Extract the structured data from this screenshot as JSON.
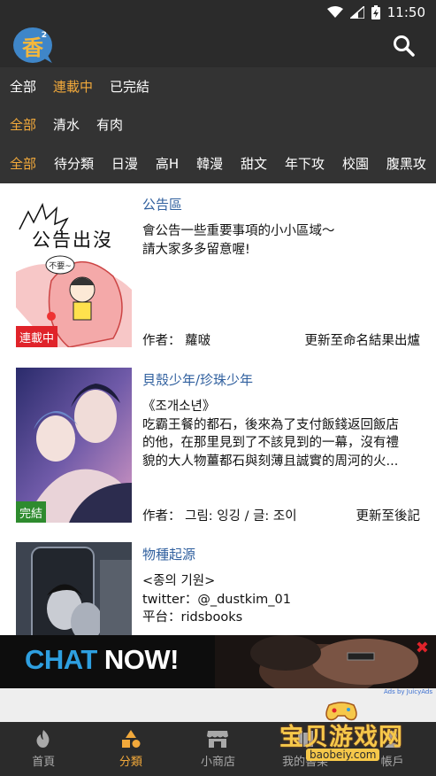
{
  "status_bar": {
    "time": "11:50"
  },
  "header": {
    "logo_text": "香",
    "logo_sup": "2"
  },
  "filters": {
    "status": [
      {
        "label": "全部",
        "active": false
      },
      {
        "label": "連載中",
        "active": true
      },
      {
        "label": "已完結",
        "active": false
      }
    ],
    "type": [
      {
        "label": "全部",
        "active": true
      },
      {
        "label": "清水",
        "active": false
      },
      {
        "label": "有肉",
        "active": false
      }
    ],
    "genre": [
      {
        "label": "全部",
        "active": true
      },
      {
        "label": "待分類",
        "active": false
      },
      {
        "label": "日漫",
        "active": false
      },
      {
        "label": "高H",
        "active": false
      },
      {
        "label": "韓漫",
        "active": false
      },
      {
        "label": "甜文",
        "active": false
      },
      {
        "label": "年下攻",
        "active": false
      },
      {
        "label": "校園",
        "active": false
      },
      {
        "label": "腹黑攻",
        "active": false
      }
    ]
  },
  "items": [
    {
      "title": "公告區",
      "desc": [
        "會公告一些重要事項的小小區域～",
        "請大家多多留意喔!"
      ],
      "thumb_text": "公告出沒",
      "bubble_text": "不要~",
      "badge": "連載中",
      "author": "作者：  蘿啵",
      "update": "更新至命名結果出爐"
    },
    {
      "title": "貝殼少年/珍珠少年",
      "desc": [
        "《조개소년》",
        "吃霸王餐的都石，後來為了支付飯錢返回飯店",
        "的他，在那里見到了不該見到的一幕，沒有禮",
        "貌的大人物薑都石與刻薄且誠實的周河的火..."
      ],
      "badge": "完結",
      "author": "作者：  그림: 잉깅 / 글: 조이",
      "update": "更新至後記"
    },
    {
      "title": "物種起源",
      "desc": [
        "<종의 기원>",
        "twitter：@_dustkim_01",
        "平台：ridsbooks",
        "..."
      ]
    }
  ],
  "ad": {
    "text_part1": "CHAT",
    "text_part2": "NOW!",
    "close": "✖",
    "credit": "Ads by JuicyAds"
  },
  "nav": [
    {
      "label": "首頁",
      "icon": "flame-icon",
      "active": false
    },
    {
      "label": "分類",
      "icon": "shapes-icon",
      "active": true
    },
    {
      "label": "小商店",
      "icon": "store-icon",
      "active": false
    },
    {
      "label": "我的書架",
      "icon": "bookshelf-icon",
      "active": false
    },
    {
      "label": "帳戶",
      "icon": "account-icon",
      "active": false
    }
  ],
  "watermark": {
    "text": "宝贝游戏网",
    "url": "baobeiy.com"
  },
  "colors": {
    "accent": "#f2a93b",
    "header_bg": "#2b2b2b",
    "filter_bg": "#333333",
    "title_link": "#2f5f9e",
    "badge_ongoing": "#e0232a",
    "badge_done": "#2e8b2e"
  }
}
